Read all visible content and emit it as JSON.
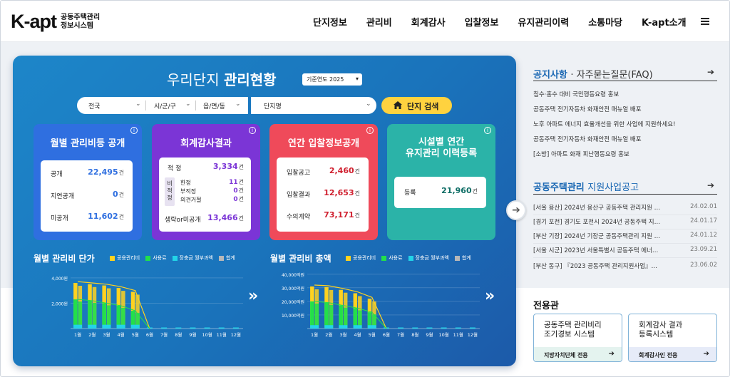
{
  "header": {
    "logo_main": "K-apt",
    "logo_sub1": "공동주택관리",
    "logo_sub2": "정보시스템",
    "nav": [
      "단지정보",
      "관리비",
      "회계감사",
      "입찰정보",
      "유지관리이력",
      "소통마당",
      "K-apt소개"
    ]
  },
  "hero": {
    "title_light": "우리단지",
    "title_bold": "관리현황",
    "year_select": "기준연도 2025",
    "filters": [
      "전국",
      "시/군/구",
      "읍/면/동",
      "단지명"
    ],
    "search_button": "단지 검색"
  },
  "boxes": {
    "fee": {
      "title": "월별 관리비등 공개",
      "rows": [
        {
          "label": "공개",
          "value": "22,495",
          "unit": "건"
        },
        {
          "label": "지연공개",
          "value": "0",
          "unit": "건"
        },
        {
          "label": "미공개",
          "value": "11,602",
          "unit": "건"
        }
      ],
      "color": "#2f6fe0"
    },
    "audit": {
      "title": "회계감사결과",
      "proper_label": "적 정",
      "proper_value": "3,334",
      "non_label": "비적정",
      "sub_rows": [
        {
          "label": "한정",
          "value": "11"
        },
        {
          "label": "부적정",
          "value": "0"
        },
        {
          "label": "의견거절",
          "value": "0"
        }
      ],
      "omit_label": "생략or미공개",
      "omit_value": "13,466",
      "unit": "건",
      "color": "#7b35d6"
    },
    "bid": {
      "title": "연간 입찰정보공개",
      "rows": [
        {
          "label": "입찰공고",
          "value": "2,460",
          "unit": "건"
        },
        {
          "label": "입찰결과",
          "value": "12,653",
          "unit": "건"
        },
        {
          "label": "수의계약",
          "value": "73,171",
          "unit": "건"
        }
      ],
      "color": "#ef4a5a"
    },
    "maint": {
      "title_line1": "시설별 연간",
      "title_line2": "유지관리 이력등록",
      "row_label": "등록",
      "row_value": "21,960",
      "unit": "건",
      "color": "#2bb3a8"
    }
  },
  "legend": [
    "공용관리비",
    "사용료",
    "장충금 월부과액",
    "합계"
  ],
  "legend_colors": [
    "#ffd21f",
    "#22e04a",
    "#22d4e8",
    "#b8b8b8"
  ],
  "chart_data": [
    {
      "type": "bar",
      "title": "월별 관리비 단가",
      "categories": [
        "1월",
        "2월",
        "3월",
        "4월",
        "5월",
        "6월",
        "7월",
        "8월",
        "9월",
        "10월",
        "11월",
        "12월"
      ],
      "yticks": [
        "4,000원",
        "2,000원"
      ],
      "ylim": [
        0,
        4500
      ],
      "series": [
        {
          "name": "공용관리비",
          "values": [
            3600,
            3500,
            3400,
            3200,
            2900,
            0,
            0,
            0,
            0,
            0,
            0,
            0
          ]
        },
        {
          "name": "사용료",
          "values": [
            2300,
            2200,
            2000,
            1800,
            1400,
            0,
            0,
            0,
            0,
            0,
            0,
            0
          ]
        },
        {
          "name": "장충금 월부과액",
          "values": [
            300,
            300,
            300,
            300,
            300,
            0,
            0,
            0,
            0,
            0,
            0,
            0
          ]
        },
        {
          "name": "합계",
          "values": [
            3700,
            3600,
            3500,
            3300,
            3000,
            0,
            0,
            0,
            0,
            0,
            0,
            0
          ]
        }
      ]
    },
    {
      "type": "bar",
      "title": "월별 관리비 총액",
      "categories": [
        "1월",
        "2월",
        "3월",
        "4월",
        "5월",
        "6월",
        "7월",
        "8월",
        "9월",
        "10월",
        "11월",
        "12월"
      ],
      "yticks": [
        "40,000억원",
        "30,000억원",
        "20,000억원",
        "10,000억원"
      ],
      "ylim": [
        0,
        42000
      ],
      "series": [
        {
          "name": "공용관리비",
          "values": [
            31000,
            30500,
            28500,
            26000,
            22000,
            0,
            0,
            0,
            0,
            0,
            0,
            0
          ]
        },
        {
          "name": "사용료",
          "values": [
            20000,
            19000,
            17000,
            15000,
            12000,
            0,
            0,
            0,
            0,
            0,
            0,
            0
          ]
        },
        {
          "name": "장충금 월부과액",
          "values": [
            2500,
            2500,
            2500,
            2500,
            2500,
            0,
            0,
            0,
            0,
            0,
            0,
            0
          ]
        },
        {
          "name": "합계",
          "values": [
            32000,
            31500,
            29500,
            27000,
            23000,
            0,
            0,
            0,
            0,
            0,
            0,
            0
          ]
        }
      ]
    }
  ],
  "notices": {
    "title": "공지사항",
    "title2": "자주묻는질문(FAQ)",
    "items": [
      "침수·홍수 대비 국민행동요령 홍보",
      "공동주택 전기자동차 화재안전 매뉴얼 배포",
      "노후 아파트 에너지 효율개선을 위한 사업에 지원하세요!",
      "공동주택 전기자동차 화재안전 매뉴얼 배포",
      "[소방] 아파트 화재 피난행동요령 홍보"
    ]
  },
  "support": {
    "title_bold": "공동주택관리",
    "title_light": "지원사업공고",
    "items": [
      {
        "text": "[서울 용산] 2024년 용산구 공동주택 관리지원 …",
        "date": "24.02.01"
      },
      {
        "text": "[경기 포천] 경기도 포천시 2024년 공동주택 지…",
        "date": "24.01.17"
      },
      {
        "text": "[부산 기장] 2024년 기장군 공동주택관리 지원 …",
        "date": "24.01.12"
      },
      {
        "text": "[서울 시군] 2023년 서울특별시 공동주택 에너…",
        "date": "23.09.21"
      },
      {
        "text": "[부산 동구] 『2023 공동주택 관리지원사업』…",
        "date": "23.06.02"
      }
    ]
  },
  "dedicated": {
    "title": "전용관",
    "cards": [
      {
        "line1": "공동주택 관리비리",
        "line2": "조기경보 시스템",
        "foot": "지방자치단체 전용",
        "foot_color": "#e4f3ef"
      },
      {
        "line1": "회계감사 결과",
        "line2": "등록시스템",
        "foot": "회계감사인 전용",
        "foot_color": "#e6ebf8"
      }
    ]
  }
}
